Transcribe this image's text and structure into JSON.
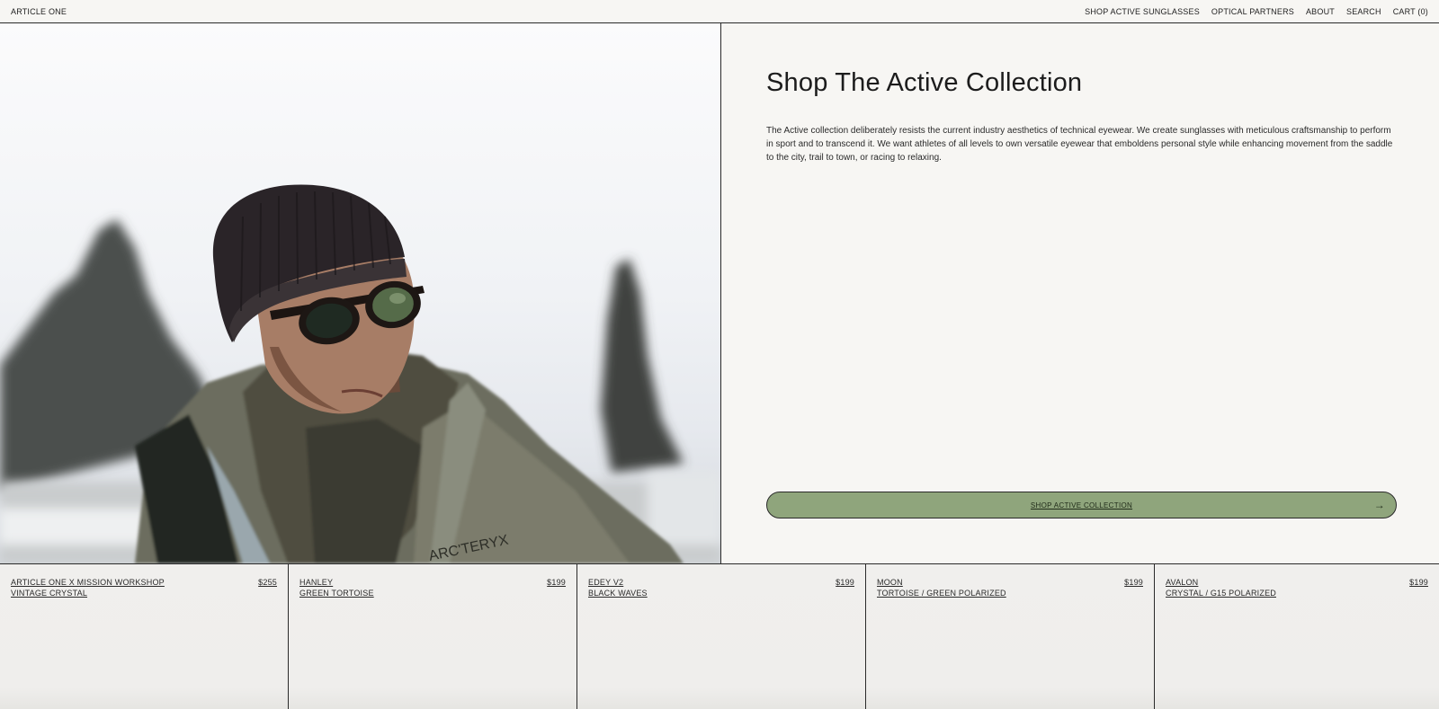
{
  "nav": {
    "brand": "ARTICLE ONE",
    "links": [
      "SHOP ACTIVE SUNGLASSES",
      "OPTICAL PARTNERS",
      "ABOUT",
      "SEARCH",
      "CART (0)"
    ]
  },
  "intro": {
    "title": "Shop The Active Collection",
    "body": "The Active collection deliberately resists the current industry aesthetics of technical eyewear. We create sunglasses with meticulous craftsmanship to perform in sport and to transcend it. We want athletes of all levels to own versatile eyewear that emboldens personal style while enhancing movement from the saddle to the city, trail to town, or racing to relaxing.",
    "cta_label": "SHOP ACTIVE COLLECTION",
    "cta_icon": "arrow-right-icon",
    "accent": "#8fa57c"
  },
  "hero": {
    "jacket_logo": "ARC'TERYX"
  },
  "products": [
    {
      "name": "ARTICLE ONE X MISSION WORKSHOP",
      "variant": "VINTAGE CRYSTAL",
      "price": "$255"
    },
    {
      "name": "HANLEY",
      "variant": "GREEN TORTOISE",
      "price": "$199"
    },
    {
      "name": "EDEY V2",
      "variant": "BLACK WAVES",
      "price": "$199"
    },
    {
      "name": "MOON",
      "variant": "TORTOISE / GREEN POLARIZED",
      "price": "$199"
    },
    {
      "name": "AVALON",
      "variant": "CRYSTAL / G15 POLARIZED",
      "price": "$199"
    }
  ]
}
